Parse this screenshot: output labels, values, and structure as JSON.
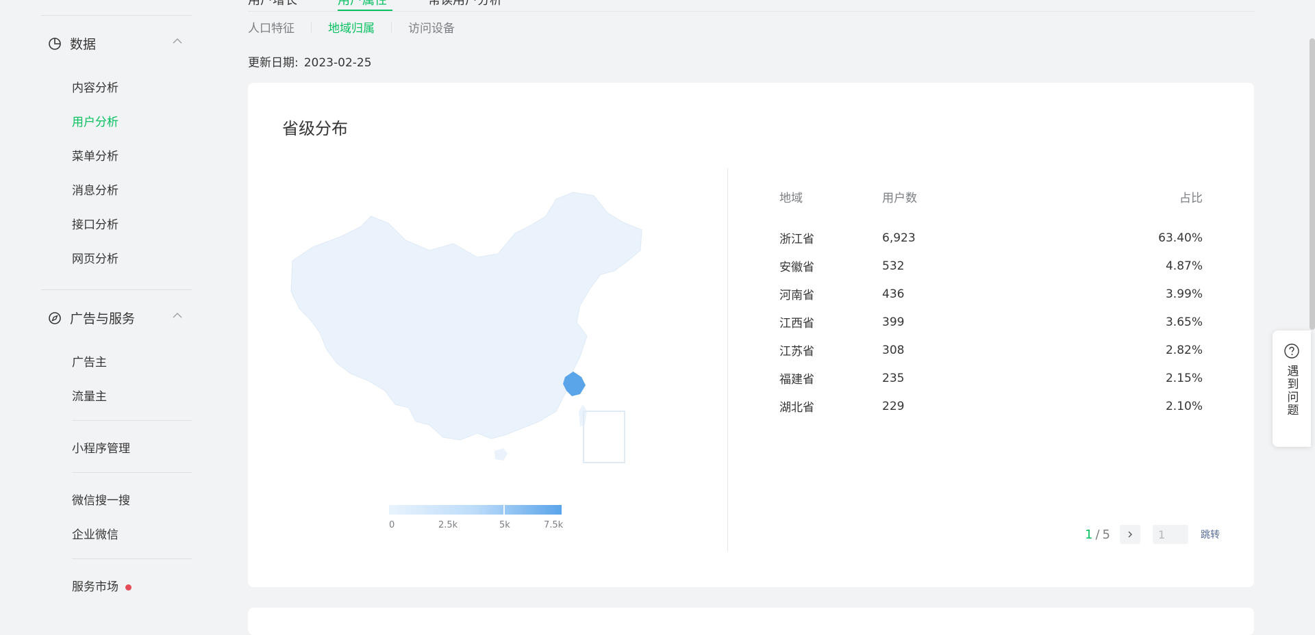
{
  "sidebar": {
    "sections": [
      {
        "label": "数据",
        "items": [
          "内容分析",
          "用户分析",
          "菜单分析",
          "消息分析",
          "接口分析",
          "网页分析"
        ],
        "active": "用户分析"
      },
      {
        "label": "广告与服务",
        "items": [
          "广告主",
          "流量主"
        ]
      }
    ],
    "standalone": [
      "小程序管理",
      "微信搜一搜",
      "企业微信",
      "服务市场"
    ]
  },
  "top_tabs": {
    "partial": [
      "用户增长",
      "用户属性",
      "常读用户分析"
    ]
  },
  "sub_tabs": [
    "人口特征",
    "地域归属",
    "访问设备"
  ],
  "active_sub_tab": "地域归属",
  "update": {
    "label": "更新日期:",
    "value": "2023-02-25"
  },
  "card": {
    "title": "省级分布",
    "legend": {
      "labels": [
        "0",
        "2.5k",
        "5k",
        "7.5k"
      ],
      "low_color": "#e9f3fd",
      "high_color": "#5aa4ea",
      "highlight_color": "#5aa4ea"
    },
    "table": {
      "headers": [
        "地域",
        "用户数",
        "占比"
      ],
      "rows": [
        [
          "浙江省",
          "6,923",
          "63.40%"
        ],
        [
          "安徽省",
          "532",
          "4.87%"
        ],
        [
          "河南省",
          "436",
          "3.99%"
        ],
        [
          "江西省",
          "399",
          "3.65%"
        ],
        [
          "江苏省",
          "308",
          "2.82%"
        ],
        [
          "福建省",
          "235",
          "2.15%"
        ],
        [
          "湖北省",
          "229",
          "2.10%"
        ]
      ]
    },
    "pager": {
      "current": "1",
      "total": "5",
      "input_placeholder": "1",
      "jump_label": "跳转"
    }
  },
  "help": {
    "label": "遇到问题"
  },
  "colors": {
    "accent": "#07c160",
    "text": "#353535",
    "muted": "#7b7f83",
    "background": "#f2f3f5"
  }
}
